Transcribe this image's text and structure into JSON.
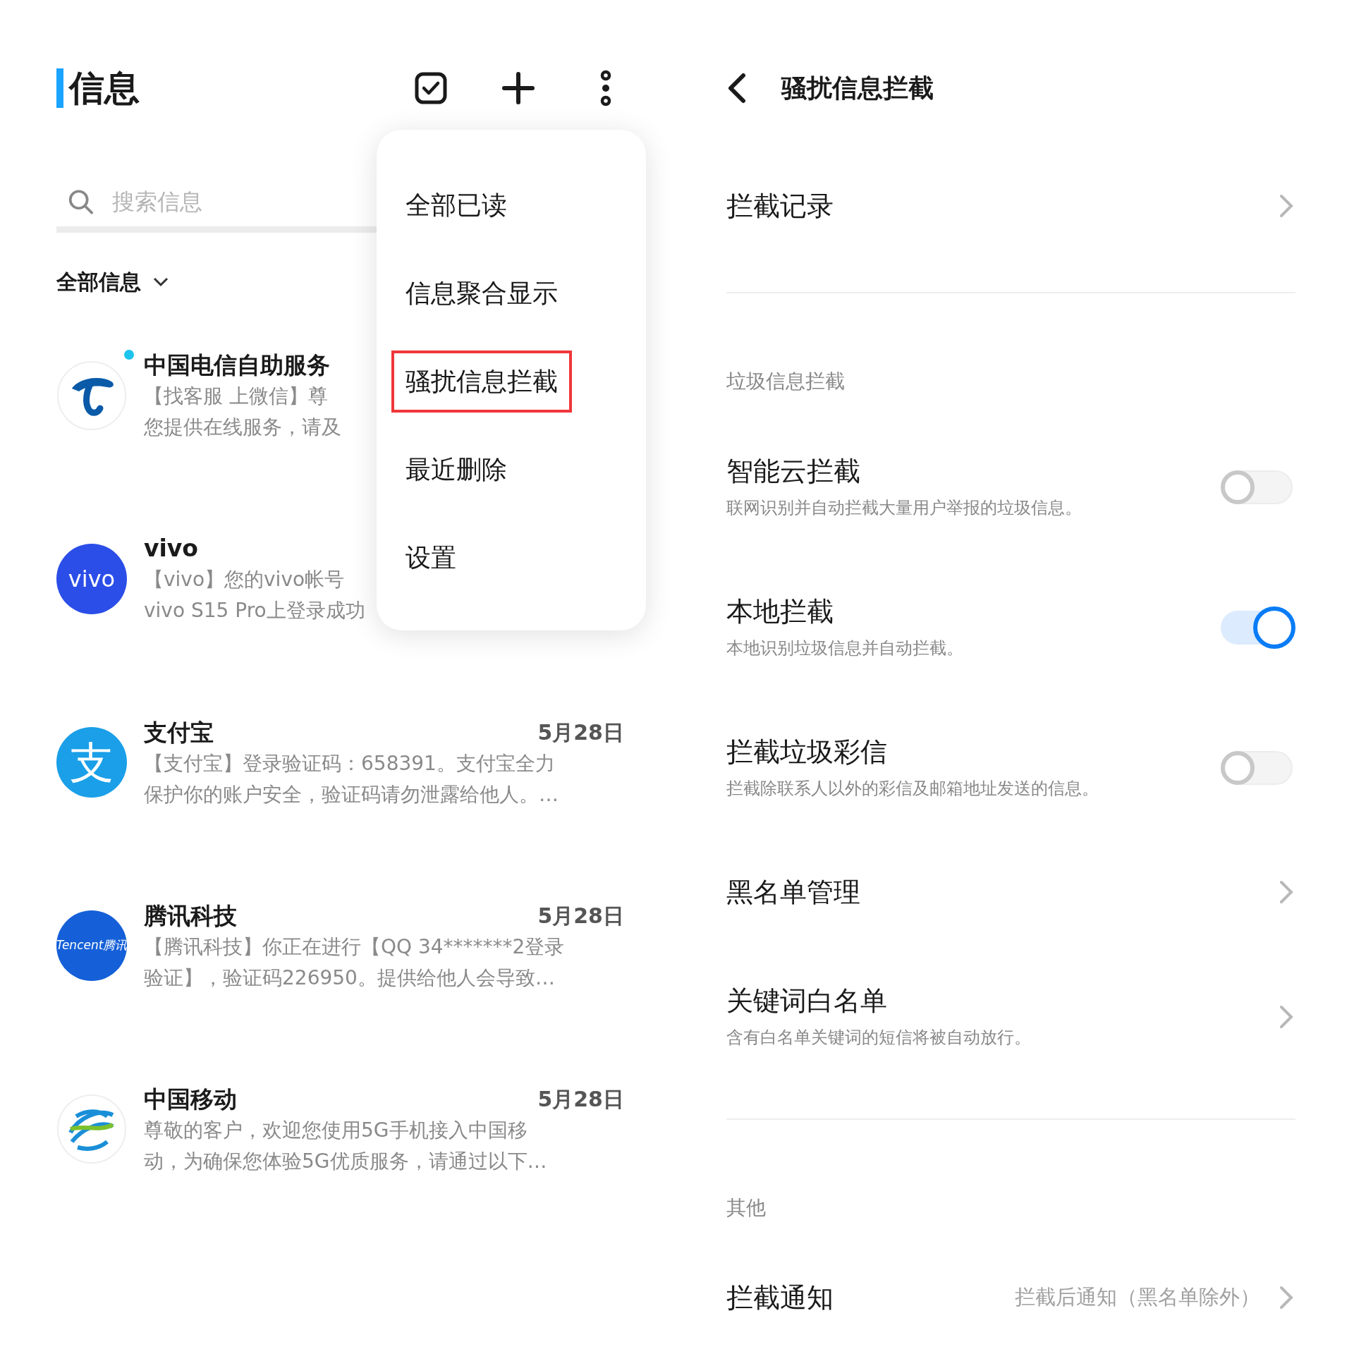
{
  "messages_screen": {
    "title": "信息",
    "search": {
      "placeholder": "搜索信息"
    },
    "filter": "全部信息",
    "conversations": [
      {
        "name": "中国电信自助服务",
        "unread": true,
        "avatar": {
          "kind": "swirl"
        },
        "preview": [
          "【找客服 上微信】尊",
          "您提供在线服务，请及"
        ]
      },
      {
        "name": "vivo",
        "unread": false,
        "avatar": {
          "kind": "text",
          "text": "vivo",
          "color": "#2b4ee8"
        },
        "preview": [
          "【vivo】您的vivo帐号",
          "vivo S15 Pro上登录成功"
        ]
      },
      {
        "name": "支付宝",
        "date": "5月28日",
        "unread": false,
        "avatar": {
          "kind": "text",
          "text": "支",
          "color": "#1a9fe8"
        },
        "preview": [
          "【支付宝】登录验证码：658391。支付宝全力",
          "保护你的账户安全，验证码请勿泄露给他人。…"
        ]
      },
      {
        "name": "腾讯科技",
        "date": "5月28日",
        "unread": false,
        "avatar": {
          "kind": "text",
          "text": "Tencent腾讯",
          "color": "#1560d8"
        },
        "preview": [
          "【腾讯科技】你正在进行【QQ 34*******2登录",
          "验证】，验证码226950。提供给他人会导致…"
        ]
      },
      {
        "name": "中国移动",
        "date": "5月28日",
        "unread": false,
        "avatar": {
          "kind": "rings"
        },
        "preview": [
          "尊敬的客户，欢迎您使用5G手机接入中国移",
          "动，为确保您体验5G优质服务，请通过以下…"
        ]
      }
    ],
    "menu": [
      {
        "label": "全部已读",
        "highlighted": false
      },
      {
        "label": "信息聚合显示",
        "highlighted": false
      },
      {
        "label": "骚扰信息拦截",
        "highlighted": true
      },
      {
        "label": "最近删除",
        "highlighted": false
      },
      {
        "label": "设置",
        "highlighted": false
      }
    ]
  },
  "block_screen": {
    "title": "骚扰信息拦截",
    "groups": [
      {
        "items": [
          {
            "kind": "nav",
            "title": "拦截记录"
          }
        ]
      },
      {
        "heading": "垃圾信息拦截",
        "items": [
          {
            "kind": "toggle",
            "title": "智能云拦截",
            "description": "联网识别并自动拦截大量用户举报的垃圾信息。",
            "on": false
          },
          {
            "kind": "toggle",
            "title": "本地拦截",
            "description": "本地识别垃圾信息并自动拦截。",
            "on": true
          },
          {
            "kind": "toggle",
            "title": "拦截垃圾彩信",
            "description": "拦截除联系人以外的彩信及邮箱地址发送的信息。",
            "on": false
          },
          {
            "kind": "nav",
            "title": "黑名单管理"
          },
          {
            "kind": "nav",
            "title": "关键词白名单",
            "description": "含有白名单关键词的短信将被自动放行。"
          }
        ]
      },
      {
        "heading": "其他",
        "items": [
          {
            "kind": "nav",
            "title": "拦截通知",
            "value": "拦截后通知（黑名单除外）"
          }
        ]
      }
    ]
  }
}
